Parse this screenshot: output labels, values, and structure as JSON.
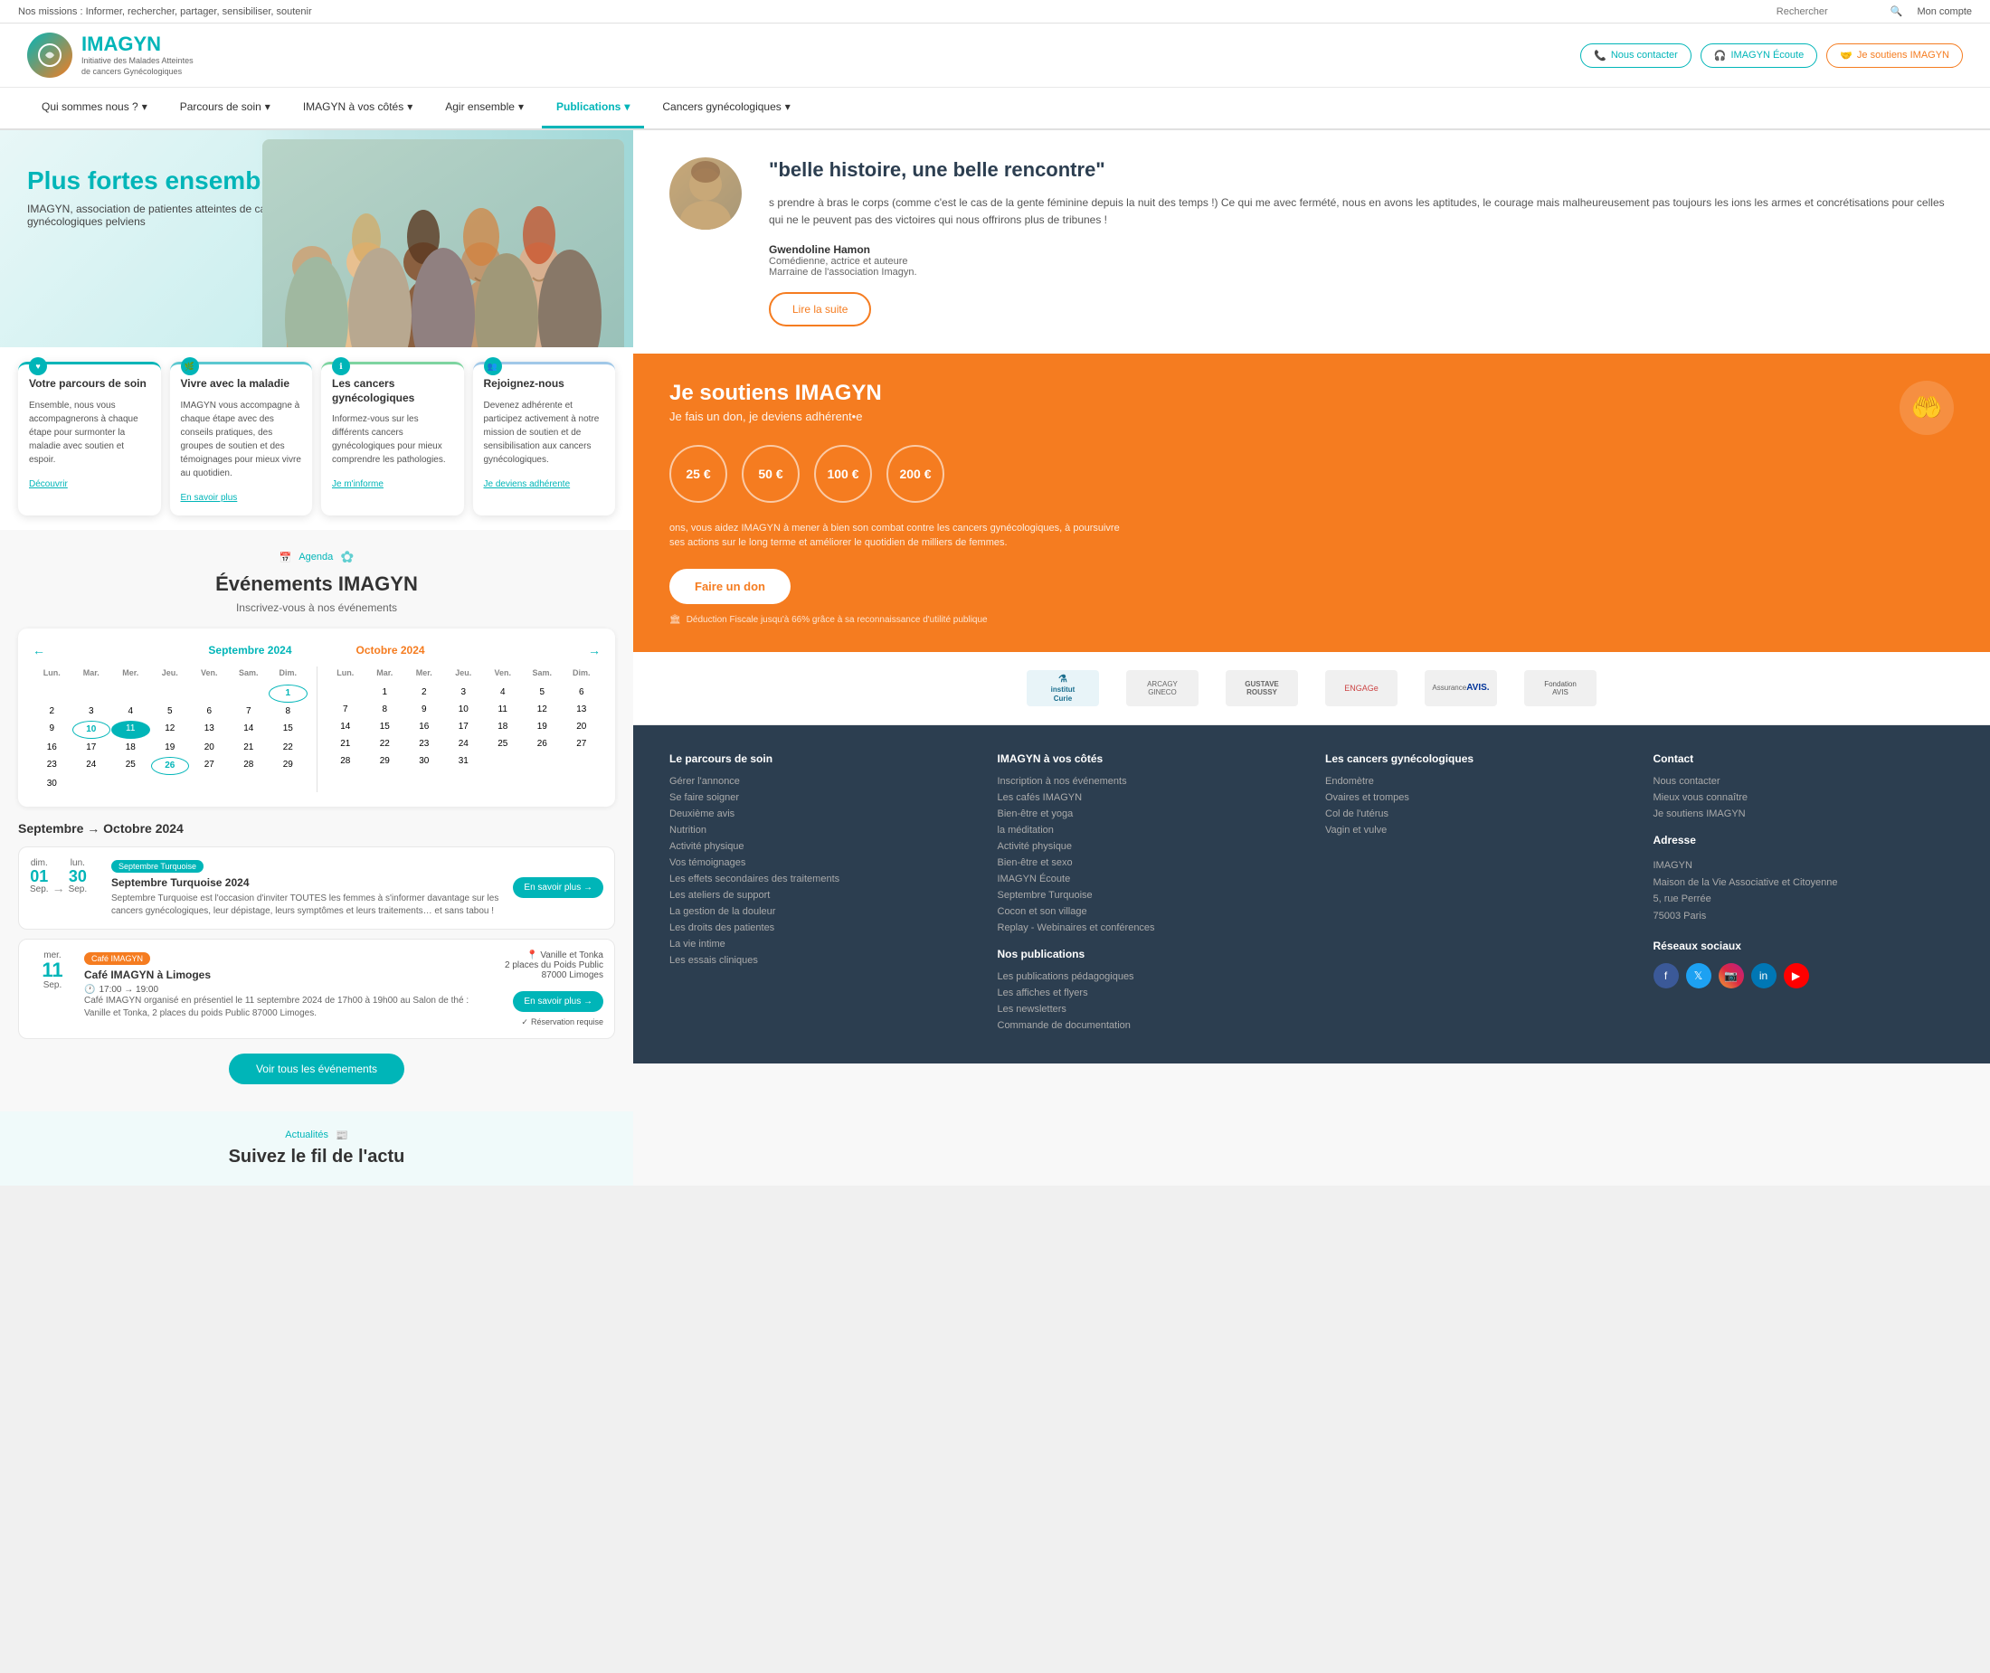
{
  "site": {
    "mission": "Nos missions : Informer, rechercher, partager, sensibiliser, soutenir",
    "search_placeholder": "Rechercher",
    "account": "Mon compte"
  },
  "header": {
    "logo_text": "IMAGYN",
    "logo_sub": "Initiative des Malades Atteintes de cancers Gynécologiques",
    "btn_contact": "Nous contacter",
    "btn_ecoute": "IMAGYN Écoute",
    "btn_soutiens": "Je soutiens IMAGYN"
  },
  "nav": {
    "items": [
      {
        "label": "Qui sommes nous ?",
        "has_dropdown": true
      },
      {
        "label": "Parcours de soin",
        "has_dropdown": true
      },
      {
        "label": "IMAGYN à vos côtés",
        "has_dropdown": true
      },
      {
        "label": "Agir ensemble",
        "has_dropdown": true
      },
      {
        "label": "Publications",
        "has_dropdown": true,
        "active": true
      },
      {
        "label": "Cancers gynécologiques",
        "has_dropdown": true
      }
    ]
  },
  "hero": {
    "title": "Plus fortes ensemble !",
    "subtitle": "IMAGYN, association de patientes atteintes de cancers gynécologiques pelviens"
  },
  "cards": [
    {
      "title": "Votre parcours de soin",
      "text": "Ensemble, nous vous accompagnerons à chaque étape pour surmonter la maladie avec soutien et espoir.",
      "link": "Découvrir"
    },
    {
      "title": "Vivre avec la maladie",
      "text": "IMAGYN vous accompagne à chaque étape avec des conseils pratiques, des groupes de soutien et des témoignages pour mieux vivre au quotidien.",
      "link": "En savoir plus"
    },
    {
      "title": "Les cancers gynécologiques",
      "text": "Informez-vous sur les différents cancers gynécologiques pour mieux comprendre les pathologies.",
      "link": "Je m'informe"
    },
    {
      "title": "Rejoignez-nous",
      "text": "Devenez adhérente et participez activement à notre mission de soutien et de sensibilisation aux cancers gynécologiques.",
      "link": "Je deviens adhérente"
    }
  ],
  "agenda": {
    "label": "Agenda",
    "title": "Événements IMAGYN",
    "subtitle": "Inscrivez-vous à nos événements",
    "calendar": {
      "month1": "Septembre",
      "year1": "2024",
      "month2": "Octobre",
      "year2": "2024",
      "days_header": [
        "Lun.",
        "Mar.",
        "Mer.",
        "Jeu.",
        "Ven.",
        "Sam.",
        "Dim."
      ],
      "sept_days": [
        "",
        "",
        "",
        "",
        "",
        "",
        "1",
        "2",
        "3",
        "4",
        "5",
        "6",
        "7",
        "8",
        "9",
        "10",
        "11",
        "12",
        "13",
        "14",
        "15",
        "16",
        "17",
        "18",
        "19",
        "20",
        "21",
        "22",
        "23",
        "24",
        "25",
        "26",
        "27",
        "28",
        "29",
        "30"
      ],
      "oct_days": [
        "1",
        "2",
        "3",
        "4",
        "5",
        "6",
        "7",
        "8",
        "9",
        "10",
        "11",
        "12",
        "13",
        "14",
        "15",
        "16",
        "17",
        "18",
        "19",
        "20",
        "21",
        "22",
        "23",
        "24",
        "25",
        "26",
        "27",
        "28",
        "29",
        "30",
        "31"
      ]
    },
    "month_range": "Septembre → Octobre 2024",
    "events": [
      {
        "day_name_start": "dim.",
        "day_num_start": "01",
        "month_abbr_start": "Sep.",
        "day_name_end": "lun.",
        "day_num_end": "30",
        "month_abbr_end": "Sep.",
        "badge": "Septembre Turquoise",
        "badge_color": "turquoise",
        "title": "Septembre Turquoise 2024",
        "desc": "Septembre Turquoise est l'occasion d'inviter TOUTES les femmes à s'informer davantage sur les cancers gynécologiques, leur dépistage, leurs symptômes et leurs traitements… et sans tabou !",
        "btn": "En savoir plus →",
        "has_range": true
      },
      {
        "day_name": "mer.",
        "day_num": "11",
        "month_abbr": "Sep.",
        "badge": "Café IMAGYN",
        "badge_color": "orange",
        "title": "Café IMAGYN à Limoges",
        "time": "17:00 → 19:00",
        "location": "Vanille et Tonka\n2 places du Poids Public\n87000 Limoges",
        "reservation": "Réservation requise",
        "desc": "Café IMAGYN organisé en présentiel le 11 septembre 2024 de 17h00 à 19h00 au Salon de thé : Vanille et Tonka, 2 places du poids Public 87000 Limoges.",
        "btn": "En savoir plus →",
        "has_range": false
      }
    ],
    "voir_btn": "Voir tous les événements"
  },
  "news": {
    "label": "Actualités",
    "title": "Suivez le fil de l'actu"
  },
  "quote": {
    "headline": "belle histoire, une belle rencontre\"",
    "text": "s prendre à bras le corps (comme c'est le cas de la gente féminine depuis la nuit des temps !) Ce qui me avec fermété, nous en avons les aptitudes, le courage mais malheureusement pas toujours les ions les armes et concrétisations pour celles qui ne le peuvent pas des victoires qui nous offrirons plus de tribunes !",
    "author": "Gwendoline Hamon",
    "role1": "Comédienne, actrice et auteure",
    "role2": "Marraine de l'association Imagyn.",
    "btn": "Lire la suite"
  },
  "support": {
    "title": "Je soutiens IMAGYN",
    "subtitle": "Je fais un don, je deviens adhérent•e",
    "amounts": [
      "25 €",
      "50 €",
      "100 €",
      "200 €"
    ],
    "desc": "ons, vous aidez IMAGYN à mener à bien son combat contre les cancers gynécologiques, à poursuivre ses actions sur le long terme et améliorer le quotidien de milliers de femmes.",
    "btn": "Faire un don",
    "tax": "Déduction Fiscale jusqu'à 66% grâce à sa reconnaissance d'utilité publique"
  },
  "partners": [
    {
      "name": "Institut Curie"
    },
    {
      "name": "ARCAGY GINECO"
    },
    {
      "name": "GUSTAVE ROUSSY"
    },
    {
      "name": "ENGAGe"
    },
    {
      "name": "AVIS"
    },
    {
      "name": "AVIS"
    }
  ],
  "footer": {
    "col1": {
      "title": "Le parcours de soin",
      "links": [
        "Gérer l'annonce",
        "Se faire soigner",
        "Deuxième avis",
        "Nutrition",
        "Activité physique",
        "Vos témoignages",
        "Les effets secondaires des traitements",
        "Les ateliers de support",
        "La gestion de la douleur",
        "Les droits des patientes",
        "La vie intime",
        "Les essais cliniques"
      ]
    },
    "col2": {
      "title": "IMAGYN à vos côtés",
      "links": [
        "Inscription à nos événements",
        "Les cafés IMAGYN",
        "Bien-être et yoga",
        "la méditation",
        "Activité physique",
        "Bien-être et sexo",
        "IMAGYN Écoute",
        "Septembre Turquoise",
        "Cocon et son village",
        "Replay - Webinaires et conférences"
      ],
      "title2": "Nos publications",
      "links2": [
        "Les publications pédagogiques",
        "Les affiches et flyers",
        "Les newsletters",
        "Commande de documentation"
      ]
    },
    "col3": {
      "title": "Les cancers gynécologiques",
      "links": [
        "Endomètre",
        "Ovaires et trompes",
        "Col de l'utérus",
        "Vagin et vulve"
      ]
    },
    "col4": {
      "title": "Contact",
      "links": [
        "Nous contacter",
        "Mieux vous connaître",
        "Je soutiens IMAGYN"
      ],
      "address_title": "Adresse",
      "address": "IMAGYN\nMaison de la Vie Associative et Citoyenne\n5, rue Perrée\n75003 Paris",
      "social_title": "Réseaux sociaux"
    }
  }
}
